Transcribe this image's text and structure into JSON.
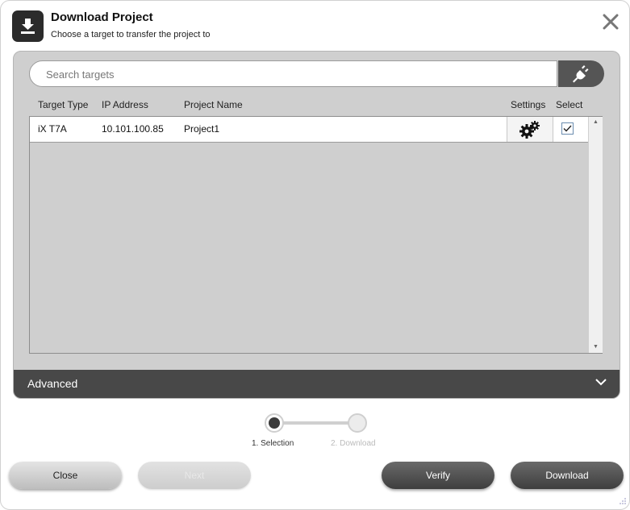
{
  "dialog": {
    "title": "Download Project",
    "subtitle": "Choose a target to transfer the project to"
  },
  "search": {
    "placeholder": "Search targets",
    "value": ""
  },
  "columns": {
    "target_type": "Target Type",
    "ip_address": "IP Address",
    "project_name": "Project Name",
    "settings": "Settings",
    "select": "Select"
  },
  "rows": [
    {
      "target_type": "iX T7A",
      "ip_address": "10.101.100.85",
      "project_name": "Project1",
      "selected": true
    }
  ],
  "advanced": {
    "label": "Advanced"
  },
  "stepper": {
    "steps": [
      {
        "label": "1. Selection",
        "active": true
      },
      {
        "label": "2. Download",
        "active": false
      }
    ]
  },
  "buttons": {
    "close": "Close",
    "next": "Next",
    "verify": "Verify",
    "download": "Download"
  },
  "icons": {
    "header": "download-icon",
    "close": "close-icon",
    "connect": "plug-connect-icon",
    "settings": "gear-icon",
    "advanced_toggle": "chevron-down-icon"
  }
}
